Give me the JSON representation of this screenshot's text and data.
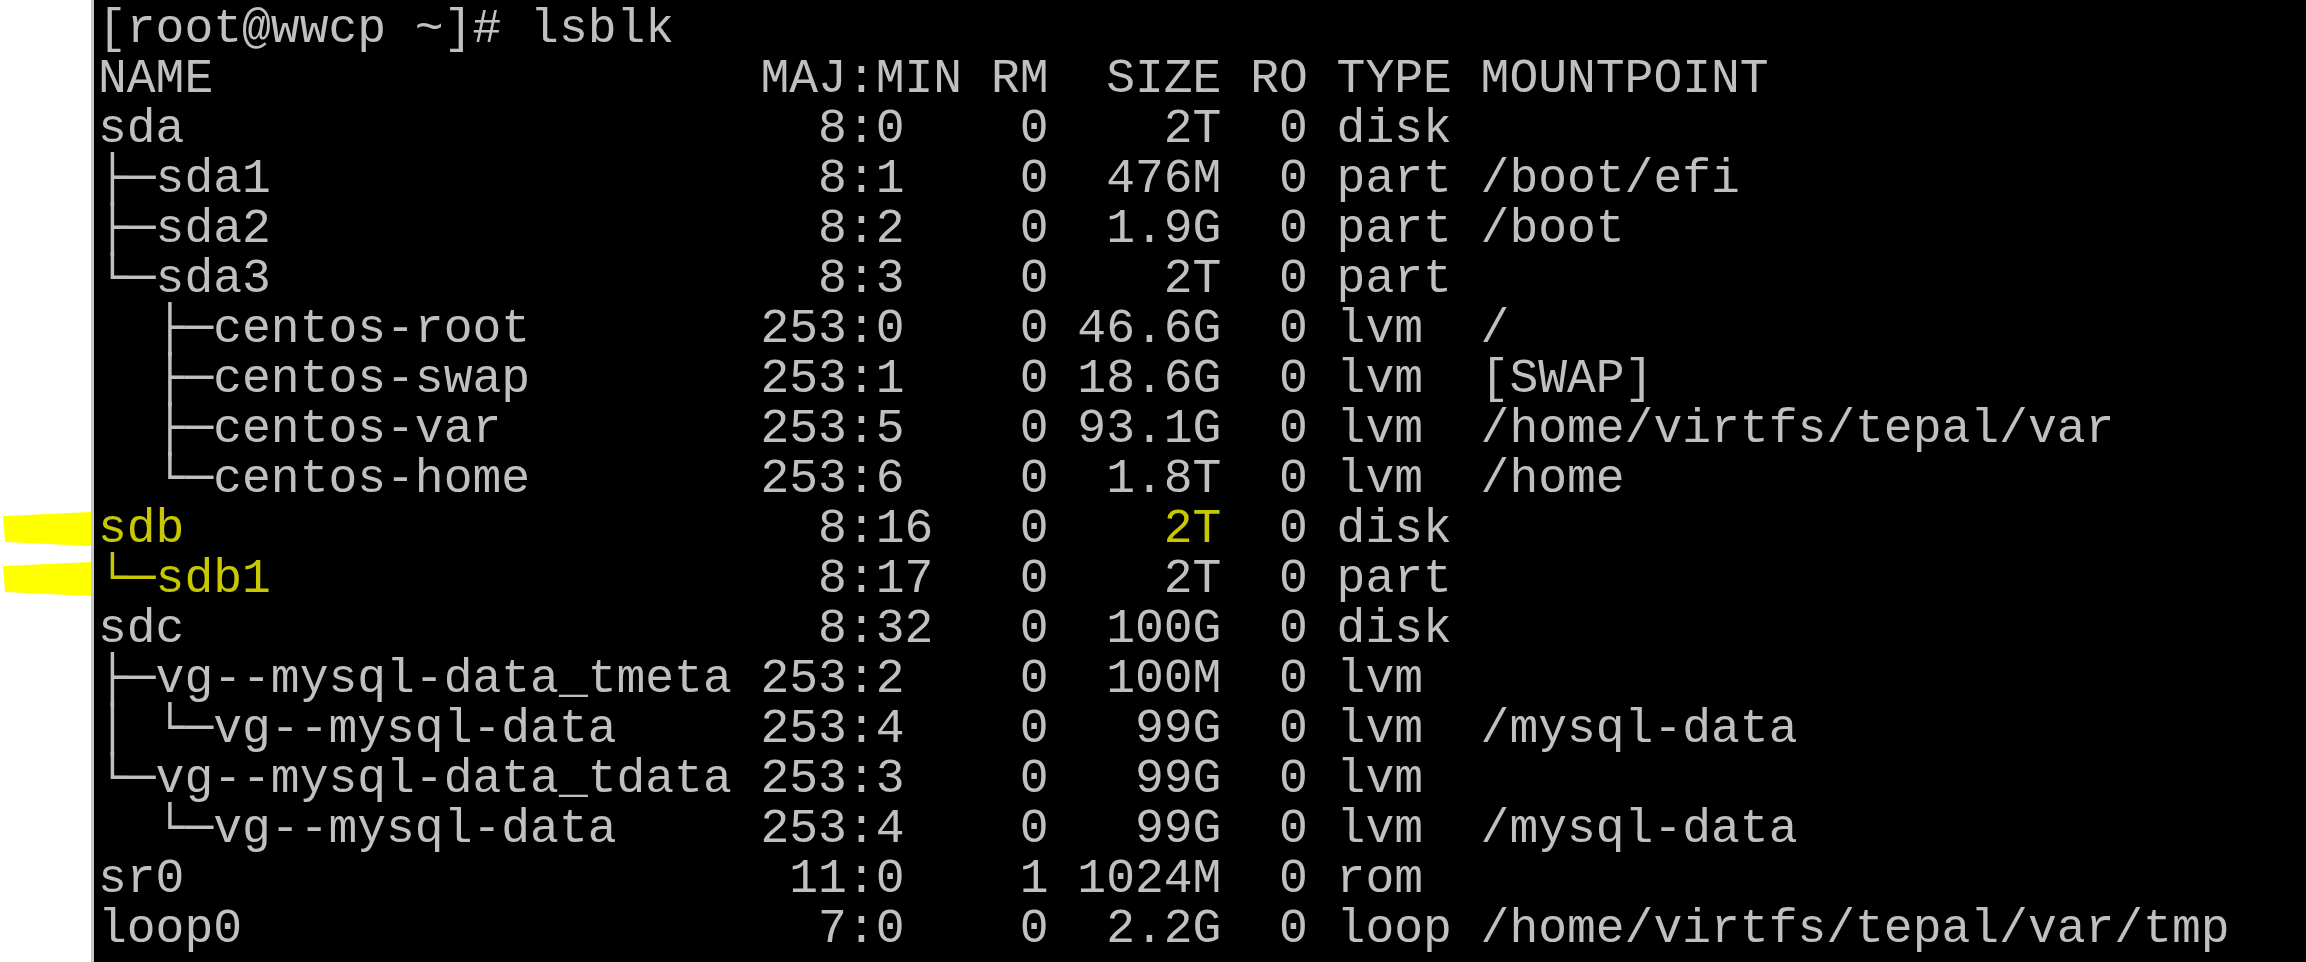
{
  "prompt": "[root@wwcp ~]# lsblk",
  "columns": [
    "NAME",
    "MAJ:MIN",
    "RM",
    "SIZE",
    "RO",
    "TYPE",
    "MOUNTPOINT"
  ],
  "rows": [
    {
      "name": "sda",
      "maj_min": "8:0",
      "rm": "0",
      "size": "2T",
      "ro": "0",
      "type": "disk",
      "marked": false,
      "size_marked": false
    },
    {
      "name": "├─sda1",
      "maj_min": "8:1",
      "rm": "0",
      "size": "476M",
      "ro": "0",
      "type": "part",
      "mountpoint": "/boot/efi",
      "marked": false,
      "size_marked": false
    },
    {
      "name": "├─sda2",
      "maj_min": "8:2",
      "rm": "0",
      "size": "1.9G",
      "ro": "0",
      "type": "part",
      "mountpoint": "/boot",
      "marked": false,
      "size_marked": false
    },
    {
      "name": "└─sda3",
      "maj_min": "8:3",
      "rm": "0",
      "size": "2T",
      "ro": "0",
      "type": "part",
      "marked": false,
      "size_marked": false
    },
    {
      "name": "  ├─centos-root",
      "maj_min": "253:0",
      "rm": "0",
      "size": "46.6G",
      "ro": "0",
      "type": "lvm",
      "mountpoint": "/",
      "marked": false,
      "size_marked": false
    },
    {
      "name": "  ├─centos-swap",
      "maj_min": "253:1",
      "rm": "0",
      "size": "18.6G",
      "ro": "0",
      "type": "lvm",
      "mountpoint": "[SWAP]",
      "marked": false,
      "size_marked": false
    },
    {
      "name": "  ├─centos-var",
      "maj_min": "253:5",
      "rm": "0",
      "size": "93.1G",
      "ro": "0",
      "type": "lvm",
      "mountpoint": "/home/virtfs/tepal/var",
      "marked": false,
      "size_marked": false
    },
    {
      "name": "  └─centos-home",
      "maj_min": "253:6",
      "rm": "0",
      "size": "1.8T",
      "ro": "0",
      "type": "lvm",
      "mountpoint": "/home",
      "marked": false,
      "size_marked": false
    },
    {
      "name": "sdb",
      "maj_min": "8:16",
      "rm": "0",
      "size": "2T",
      "ro": "0",
      "type": "disk",
      "marked": true,
      "size_marked": true
    },
    {
      "name": "└─sdb1",
      "maj_min": "8:17",
      "rm": "0",
      "size": "2T",
      "ro": "0",
      "type": "part",
      "marked": true,
      "size_marked": false
    },
    {
      "name": "sdc",
      "maj_min": "8:32",
      "rm": "0",
      "size": "100G",
      "ro": "0",
      "type": "disk",
      "marked": false,
      "size_marked": false
    },
    {
      "name": "├─vg--mysql-data_tmeta",
      "maj_min": "253:2",
      "rm": "0",
      "size": "100M",
      "ro": "0",
      "type": "lvm",
      "marked": false,
      "size_marked": false
    },
    {
      "name": "│ └─vg--mysql-data",
      "maj_min": "253:4",
      "rm": "0",
      "size": "99G",
      "ro": "0",
      "type": "lvm",
      "mountpoint": "/mysql-data",
      "marked": false,
      "size_marked": false
    },
    {
      "name": "└─vg--mysql-data_tdata",
      "maj_min": "253:3",
      "rm": "0",
      "size": "99G",
      "ro": "0",
      "type": "lvm",
      "marked": false,
      "size_marked": false
    },
    {
      "name": "  └─vg--mysql-data",
      "maj_min": "253:4",
      "rm": "0",
      "size": "99G",
      "ro": "0",
      "type": "lvm",
      "mountpoint": "/mysql-data",
      "marked": false,
      "size_marked": false
    },
    {
      "name": "sr0",
      "maj_min": "11:0",
      "rm": "1",
      "size": "1024M",
      "ro": "0",
      "type": "rom",
      "marked": false,
      "size_marked": false
    },
    {
      "name": "loop0",
      "maj_min": "7:0",
      "rm": "0",
      "size": "2.2G",
      "ro": "0",
      "type": "loop",
      "mountpoint": "/home/virtfs/tepal/var/tmp",
      "marked": false,
      "size_marked": false
    }
  ]
}
